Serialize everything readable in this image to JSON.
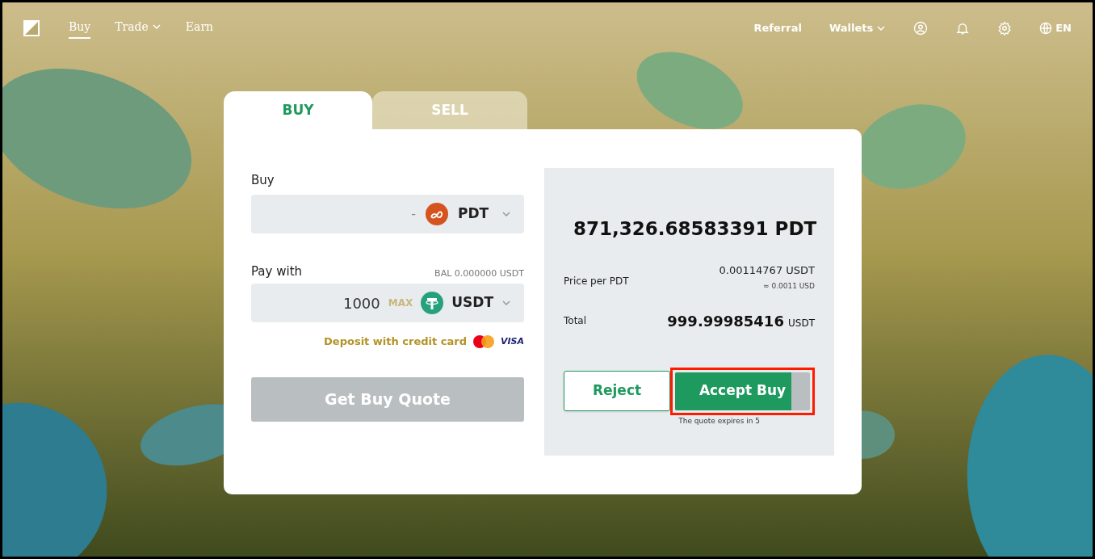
{
  "nav": {
    "links": [
      {
        "label": "Buy",
        "selected": true,
        "dropdown": false
      },
      {
        "label": "Trade",
        "selected": false,
        "dropdown": true
      },
      {
        "label": "Earn",
        "selected": false,
        "dropdown": false
      }
    ],
    "right": [
      {
        "kind": "text",
        "label": "Referral"
      },
      {
        "kind": "dropdown",
        "label": "Wallets"
      },
      {
        "kind": "user"
      },
      {
        "kind": "bell"
      },
      {
        "kind": "gear"
      },
      {
        "kind": "globe",
        "label": "EN"
      }
    ]
  },
  "tabs": [
    {
      "label": "BUY",
      "selected": true
    },
    {
      "label": "SELL",
      "selected": false
    }
  ],
  "form": {
    "buy": {
      "label": "Buy",
      "value": "-",
      "currency": "PDT"
    },
    "pay": {
      "label": "Pay with",
      "balance": "BAL 0.000000 USDT",
      "value": "1000",
      "max": "MAX",
      "currency": "USDT"
    },
    "deposit_link": "Deposit with credit card",
    "visa": "VISA",
    "quote_button": {
      "label": "Get Buy Quote",
      "disabled": true
    }
  },
  "quote": {
    "amount": "871,326.68583391 PDT",
    "price_label": "Price per PDT",
    "price": "0.00114767 USDT",
    "price_usd": "≈ 0.0011 USD",
    "total_label": "Total",
    "total": "999.99985416",
    "total_unit": "USDT",
    "reject": "Reject",
    "accept": {
      "label": "Accept Buy",
      "level": 0.86,
      "highlighted": true
    },
    "expiry": "The quote expires in 5"
  }
}
